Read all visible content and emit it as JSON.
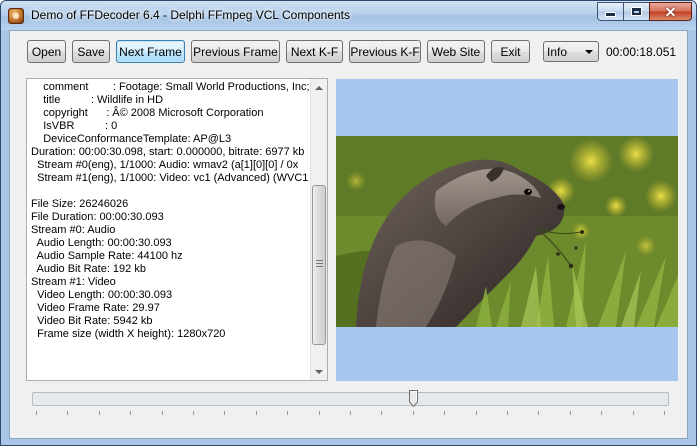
{
  "window": {
    "title": "Demo of FFDecoder 6.4 - Delphi FFmpeg VCL Components"
  },
  "toolbar": {
    "buttons": [
      "Open",
      "Save",
      "Next Frame",
      "Previous Frame",
      "Next K-F",
      "Previous K-F",
      "Web Site",
      "Exit"
    ],
    "focused_button": "Next Frame",
    "combo_value": "Info",
    "time_display": "00:00:18.051"
  },
  "info_memo": {
    "lines": [
      "    comment        : Footage: Small World Productions, Inc; T",
      "    title          : Wildlife in HD",
      "    copyright      : Â© 2008 Microsoft Corporation",
      "    IsVBR          : 0",
      "    DeviceConformanceTemplate: AP@L3",
      "Duration: 00:00:30.098, start: 0.000000, bitrate: 6977 kb",
      "  Stream #0(eng), 1/1000: Audio: wmav2 (a[1][0][0] / 0x",
      "  Stream #1(eng), 1/1000: Video: vc1 (Advanced) (WVC1",
      "",
      "File Size: 26246026",
      "File Duration: 00:00:30.093",
      "Stream #0: Audio",
      "  Audio Length: 00:00:30.093",
      "  Audio Sample Rate: 44100 hz",
      "  Audio Bit Rate: 192 kb",
      "Stream #1: Video",
      "  Video Length: 00:00:30.093",
      "  Video Frame Rate: 29.97",
      "  Video Bit Rate: 5942 kb",
      "  Frame size (width X height): 1280x720"
    ],
    "scroll_position": 0.52
  },
  "video": {
    "background_color": "#a7c7ef",
    "subject": "marmot-video-frame"
  },
  "seek_bar": {
    "position": 0.6,
    "tick_count": 20
  },
  "colors": {
    "titlebar": "#b5cfeb",
    "client": "#f0f0f0",
    "focus_border": "#3c7fb1"
  }
}
